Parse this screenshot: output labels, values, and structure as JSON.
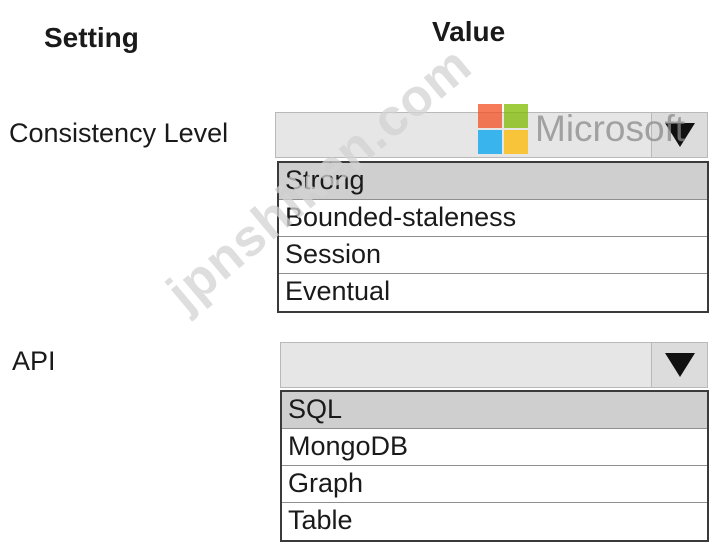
{
  "headers": {
    "setting": "Setting",
    "value": "Value"
  },
  "rows": [
    {
      "label": "Consistency Level",
      "dropdown": {
        "selected": "",
        "options": [
          "Strong",
          "Bounded-staleness",
          "Session",
          "Eventual"
        ],
        "highlighted_option": "Strong"
      }
    },
    {
      "label": "API",
      "dropdown": {
        "selected": "",
        "options": [
          "SQL",
          "MongoDB",
          "Graph",
          "Table"
        ],
        "highlighted_option": "SQL"
      }
    }
  ],
  "watermark": {
    "logo_text": "Microsoft",
    "diagonal_text": "jpnshiken.com",
    "logo_colors": [
      "#f25022",
      "#7fba00",
      "#00a4ef",
      "#ffb900"
    ]
  },
  "icons": {
    "dropdown_arrow": "triangle-down-icon"
  }
}
